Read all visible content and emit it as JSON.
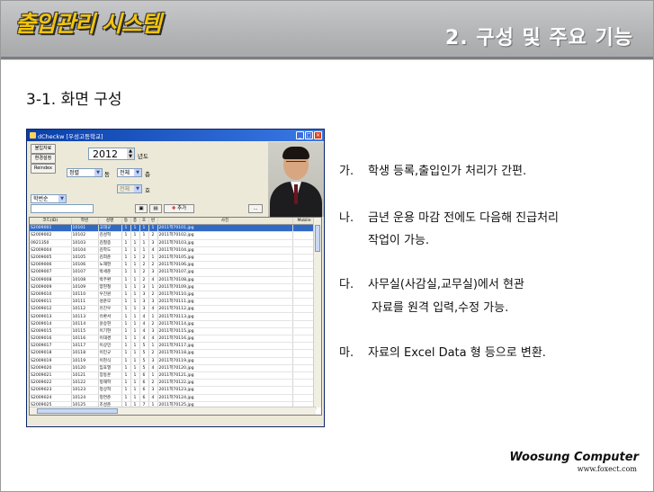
{
  "header": {
    "logo": "출입관리 시스템",
    "section": "2. 구성 및 주요 기능"
  },
  "subtitle": "3-1. 화면 구성",
  "app": {
    "title": "dCheckw [우성고등학교]",
    "side_buttons": [
      "불입자료",
      "환경설정",
      "Reindex"
    ],
    "year_value": "2012",
    "year_suffix": "년도",
    "grade_value": "정렬",
    "grade_suffix": "동",
    "class_value": "전체",
    "class_suffix": "층",
    "room_value": "전체",
    "room_suffix": "호",
    "sort_value": "학번순",
    "add_button": "추가",
    "more_button": "...",
    "columns": [
      "코드(ID)",
      "학번",
      "성명",
      "동",
      "층",
      "호",
      "번",
      "사진",
      "Mobile"
    ],
    "rows": [
      [
        "S2009001",
        "10101",
        "고태규",
        "1",
        "1",
        "1",
        "1",
        "2011학70101.jpg",
        ""
      ],
      [
        "S2009002",
        "10102",
        "김성혁",
        "1",
        "1",
        "1",
        "2",
        "2011학70102.jpg",
        ""
      ],
      [
        "0921350",
        "10103",
        "김철종",
        "1",
        "1",
        "1",
        "3",
        "2011학70103.jpg",
        ""
      ],
      [
        "S2009004",
        "10104",
        "김학도",
        "1",
        "1",
        "1",
        "4",
        "2011학70104.jpg",
        ""
      ],
      [
        "S2009005",
        "10105",
        "김희준",
        "1",
        "1",
        "2",
        "1",
        "2011학70105.jpg",
        ""
      ],
      [
        "S2009006",
        "10106",
        "노재현",
        "1",
        "1",
        "2",
        "2",
        "2011학70106.jpg",
        ""
      ],
      [
        "S2009007",
        "10107",
        "박세준",
        "1",
        "1",
        "2",
        "3",
        "2011학70107.jpg",
        ""
      ],
      [
        "S2009008",
        "10108",
        "박주환",
        "1",
        "1",
        "2",
        "4",
        "2011학70108.jpg",
        ""
      ],
      [
        "S2009009",
        "10109",
        "양현철",
        "1",
        "1",
        "3",
        "1",
        "2011학70109.jpg",
        ""
      ],
      [
        "S2009010",
        "10110",
        "우진원",
        "1",
        "1",
        "3",
        "2",
        "2011학70110.jpg",
        ""
      ],
      [
        "S2009011",
        "10111",
        "성준모",
        "1",
        "1",
        "3",
        "3",
        "2011학70111.jpg",
        ""
      ],
      [
        "S2009012",
        "10112",
        "유진우",
        "1",
        "1",
        "3",
        "4",
        "2011학70112.jpg",
        ""
      ],
      [
        "S2009013",
        "10113",
        "유환서",
        "1",
        "1",
        "4",
        "1",
        "2011학70113.jpg",
        ""
      ],
      [
        "S2009014",
        "10114",
        "윤승현",
        "1",
        "1",
        "4",
        "2",
        "2011학70114.jpg",
        ""
      ],
      [
        "S2009015",
        "10115",
        "이기현",
        "1",
        "1",
        "4",
        "3",
        "2011학70115.jpg",
        ""
      ],
      [
        "S2009016",
        "10116",
        "이대경",
        "1",
        "1",
        "4",
        "4",
        "2011학70116.jpg",
        ""
      ],
      [
        "S2009017",
        "10117",
        "이상민",
        "1",
        "1",
        "5",
        "1",
        "2011학70117.jpg",
        ""
      ],
      [
        "S2009018",
        "10118",
        "이민규",
        "1",
        "1",
        "5",
        "2",
        "2011학70118.jpg",
        ""
      ],
      [
        "S2009019",
        "10119",
        "이현식",
        "1",
        "1",
        "5",
        "3",
        "2011학70119.jpg",
        ""
      ],
      [
        "S2009020",
        "10120",
        "임효열",
        "1",
        "1",
        "5",
        "4",
        "2011학70120.jpg",
        ""
      ],
      [
        "S2009021",
        "10121",
        "장동훈",
        "1",
        "1",
        "6",
        "1",
        "2011학70121.jpg",
        ""
      ],
      [
        "S2009022",
        "10122",
        "정재학",
        "1",
        "1",
        "6",
        "2",
        "2011학70122.jpg",
        ""
      ],
      [
        "S2009023",
        "10123",
        "정상혁",
        "1",
        "1",
        "6",
        "3",
        "2011학70123.jpg",
        ""
      ],
      [
        "S2009024",
        "10124",
        "정연준",
        "1",
        "1",
        "6",
        "4",
        "2011학70124.jpg",
        ""
      ],
      [
        "S2009025",
        "10125",
        "조성준",
        "1",
        "1",
        "7",
        "1",
        "2011학70125.jpg",
        ""
      ]
    ]
  },
  "items": [
    {
      "mark": "가.",
      "lines": [
        "학생 등록,출입인가 처리가 간편."
      ]
    },
    {
      "mark": "나.",
      "lines": [
        "금년 운용 마감 전에도 다음해 진급처리",
        "작업이 가능."
      ]
    },
    {
      "mark": "다.",
      "lines": [
        "사무실(사감실,교무실)에서 현관",
        "자료를 원격 입력,수정 가능."
      ]
    },
    {
      "mark": "마.",
      "lines": [
        "자료의 Excel  Data 형 등으로 변환."
      ]
    }
  ],
  "footer": {
    "brand": "Woosung Computer",
    "url": "www.foxect.com"
  }
}
